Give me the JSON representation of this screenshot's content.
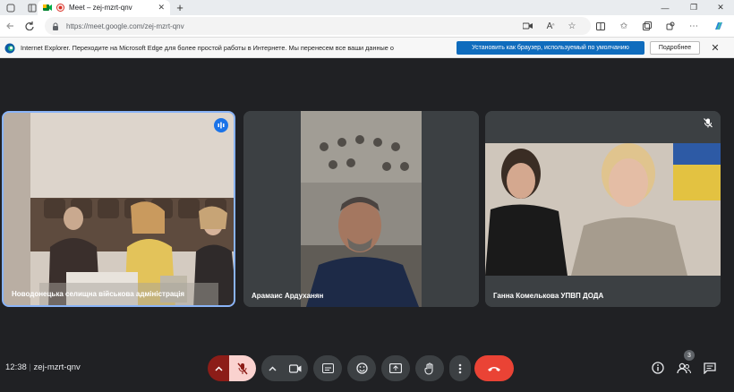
{
  "browser": {
    "tab_title": "Meet – zej-mzrt-qnv",
    "url": "https://meet.google.com/zej-mzrt-qnv",
    "window_controls": [
      "minimize",
      "restore",
      "close"
    ]
  },
  "infobar": {
    "message": "Internet Explorer. Переходите на Microsoft Edge для более простой работы в Интернете. Мы перенесем все ваши данные о",
    "primary_button": "Установить как браузер, используемый по умолчанию",
    "secondary_button": "Подробнее"
  },
  "participants": [
    {
      "name": "Новодонецька селищна військова адміністрація",
      "speaking": true,
      "muted": false
    },
    {
      "name": "Арамаис Ардуханян",
      "speaking": false,
      "muted": false
    },
    {
      "name": "Ганна Комелькова УПВП ДОДА",
      "speaking": false,
      "muted": true
    }
  ],
  "meeting": {
    "time": "12:38",
    "code": "zej-mzrt-qnv",
    "participant_count": "3"
  },
  "colors": {
    "background": "#202124",
    "tile": "#3c4043",
    "speaking_border": "#8ab4f8",
    "mic_off_bg": "#fad2cf",
    "mic_off_left": "#8c1d18",
    "end_call": "#ea4335",
    "primary_button": "#0f6cbd"
  }
}
